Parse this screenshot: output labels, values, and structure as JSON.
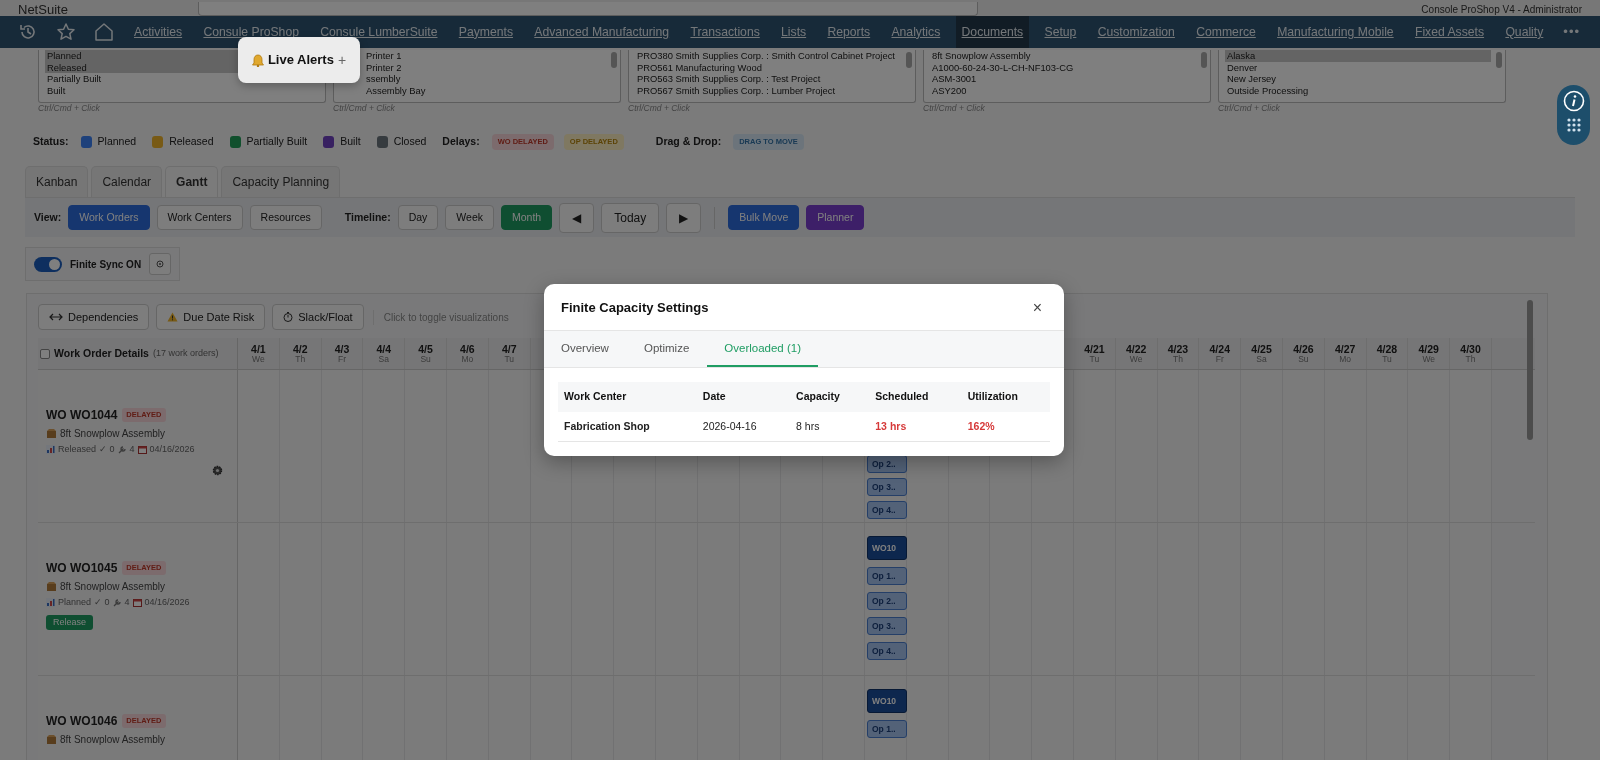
{
  "header": {
    "logo": "NetSuite",
    "user": "Console ProShop V4 - Administrator"
  },
  "nav": {
    "items": [
      {
        "label": "Activities",
        "selected": false
      },
      {
        "label": "Consule ProShop",
        "selected": false
      },
      {
        "label": "Consule LumberSuite",
        "selected": false
      },
      {
        "label": "Payments",
        "selected": false
      },
      {
        "label": "Advanced Manufacturing",
        "selected": false
      },
      {
        "label": "Transactions",
        "selected": false
      },
      {
        "label": "Lists",
        "selected": false
      },
      {
        "label": "Reports",
        "selected": false
      },
      {
        "label": "Analytics",
        "selected": false
      },
      {
        "label": "Documents",
        "selected": true
      },
      {
        "label": "Setup",
        "selected": false
      },
      {
        "label": "Customization",
        "selected": false
      },
      {
        "label": "Commerce",
        "selected": false
      },
      {
        "label": "Manufacturing Mobile",
        "selected": false
      },
      {
        "label": "Fixed Assets",
        "selected": false
      },
      {
        "label": "Quality",
        "selected": false
      }
    ],
    "more": "•••"
  },
  "live_alerts": {
    "label": "Live Alerts",
    "plus": "+"
  },
  "filters": [
    {
      "options": [
        {
          "label": "Planned",
          "selected": true
        },
        {
          "label": "Released",
          "selected": true
        },
        {
          "label": "Partially Built",
          "selected": false
        },
        {
          "label": "Built",
          "selected": false
        }
      ],
      "hint": "Ctrl/Cmd + Click"
    },
    {
      "options": [
        {
          "label": "Printer 1",
          "selected": false
        },
        {
          "label": "Printer 2",
          "selected": false
        },
        {
          "label": "ssembly",
          "selected": false
        },
        {
          "label": "Assembly Bay",
          "selected": false
        }
      ],
      "hint": "Ctrl/Cmd + Click"
    },
    {
      "options": [
        {
          "label": "PRO380 Smith Supplies Corp. : Smith Control Cabinet Project",
          "selected": false
        },
        {
          "label": "PRO561 Manufacturing Wood",
          "selected": false
        },
        {
          "label": "PRO563 Smith Supplies Corp. : Test Project",
          "selected": false
        },
        {
          "label": "PRO567 Smith Supplies Corp. : Lumber Project",
          "selected": false
        }
      ],
      "hint": "Ctrl/Cmd + Click"
    },
    {
      "options": [
        {
          "label": "8ft Snowplow Assembly",
          "selected": false
        },
        {
          "label": "A1000-60-24-30-L-CH-NF103-CG",
          "selected": false
        },
        {
          "label": "ASM-3001",
          "selected": false
        },
        {
          "label": "ASY200",
          "selected": false
        }
      ],
      "hint": "Ctrl/Cmd + Click"
    },
    {
      "options": [
        {
          "label": "Alaska",
          "selected": true
        },
        {
          "label": "Denver",
          "selected": false
        },
        {
          "label": "New Jersey",
          "selected": false
        },
        {
          "label": "Outside Processing",
          "selected": false
        }
      ],
      "hint": "Ctrl/Cmd + Click"
    }
  ],
  "legend": {
    "status_label": "Status:",
    "statuses": [
      {
        "label": "Planned",
        "color": "#1e417b"
      },
      {
        "label": "Released",
        "color": "#785a15"
      },
      {
        "label": "Partially Built",
        "color": "#11502d"
      },
      {
        "label": "Built",
        "color": "#382161"
      },
      {
        "label": "Closed",
        "color": "#363b3f"
      }
    ],
    "delays_label": "Delays:",
    "delays": [
      {
        "label": "WO DELAYED",
        "kind": "wo"
      },
      {
        "label": "OP DELAYED",
        "kind": "op"
      }
    ],
    "drag_label": "Drag & Drop:",
    "drag": "DRAG TO MOVE"
  },
  "view_tabs": [
    {
      "label": "Kanban",
      "selected": false
    },
    {
      "label": "Calendar",
      "selected": false
    },
    {
      "label": "Gantt",
      "selected": true
    },
    {
      "label": "Capacity Planning",
      "selected": false
    }
  ],
  "toolbar": {
    "view_label": "View:",
    "views": [
      {
        "label": "Work Orders",
        "selected": true
      },
      {
        "label": "Work Centers",
        "selected": false
      },
      {
        "label": "Resources",
        "selected": false
      }
    ],
    "timeline_label": "Timeline:",
    "timelines": [
      {
        "label": "Day",
        "selected": false
      },
      {
        "label": "Week",
        "selected": false
      },
      {
        "label": "Month",
        "selected": true
      }
    ],
    "prev": "◀",
    "today": "Today",
    "next": "▶",
    "actions": [
      {
        "label": "Bulk Move",
        "kind": "primary"
      },
      {
        "label": "Planner",
        "kind": "purple"
      }
    ]
  },
  "finite_sync": {
    "label": "Finite Sync ON",
    "on": true
  },
  "gantt": {
    "viz_buttons": [
      {
        "label": "Dependencies",
        "kind": "dependencies"
      },
      {
        "label": "Due Date Risk",
        "kind": "risk"
      },
      {
        "label": "Slack/Float",
        "kind": "slack"
      }
    ],
    "hint": "Click to toggle visualizations",
    "details_label": "Work Order Details",
    "details_checked": false,
    "count": "(17 work orders)",
    "days_left": [
      {
        "date": "4/1",
        "weekday": "We"
      },
      {
        "date": "4/2",
        "weekday": "Th"
      },
      {
        "date": "4/3",
        "weekday": "Fr"
      },
      {
        "date": "4/4",
        "weekday": "Sa"
      },
      {
        "date": "4/5",
        "weekday": "Su"
      },
      {
        "date": "4/6",
        "weekday": "Mo"
      },
      {
        "date": "4/7",
        "weekday": "Tu"
      }
    ],
    "days_right": [
      {
        "date": "4/21",
        "weekday": "Tu"
      },
      {
        "date": "4/22",
        "weekday": "We"
      },
      {
        "date": "4/23",
        "weekday": "Th"
      },
      {
        "date": "4/24",
        "weekday": "Fr"
      },
      {
        "date": "4/25",
        "weekday": "Sa"
      },
      {
        "date": "4/26",
        "weekday": "Su"
      },
      {
        "date": "4/27",
        "weekday": "Mo"
      },
      {
        "date": "4/28",
        "weekday": "Tu"
      },
      {
        "date": "4/29",
        "weekday": "We"
      },
      {
        "date": "4/30",
        "weekday": "Th"
      }
    ],
    "rows": [
      {
        "title": "WO WO1044",
        "badge": "DELAYED",
        "product": "8ft Snowplow Assembly",
        "meta": {
          "status": "Released",
          "done": "✓ 0",
          "ops": "4",
          "date": "04/16/2026"
        },
        "action": {
          "kind": "gear"
        },
        "bars": [
          {
            "label": "Op 2..",
            "kind": "op"
          },
          {
            "label": "Op 3..",
            "kind": "op"
          },
          {
            "label": "Op 4..",
            "kind": "op"
          }
        ]
      },
      {
        "title": "WO WO1045",
        "badge": "DELAYED",
        "product": "8ft Snowplow Assembly",
        "meta": {
          "status": "Planned",
          "done": "✓ 0",
          "ops": "4",
          "date": "04/16/2026"
        },
        "action": {
          "kind": "release",
          "label": "Release"
        },
        "bars": [
          {
            "label": "WO10",
            "kind": "wo"
          },
          {
            "label": "Op 1..",
            "kind": "op"
          },
          {
            "label": "Op 2..",
            "kind": "op"
          },
          {
            "label": "Op 3..",
            "kind": "op"
          },
          {
            "label": "Op 4..",
            "kind": "op"
          }
        ]
      },
      {
        "title": "WO WO1046",
        "badge": "DELAYED",
        "product": "8ft Snowplow Assembly",
        "bars": [
          {
            "label": "WO10",
            "kind": "wo"
          },
          {
            "label": "Op 1..",
            "kind": "op"
          }
        ]
      }
    ]
  },
  "modal": {
    "title": "Finite Capacity Settings",
    "close": "×",
    "tabs": [
      {
        "label": "Overview",
        "selected": false
      },
      {
        "label": "Optimize",
        "selected": false
      },
      {
        "label": "Overloaded (1)",
        "selected": true
      }
    ],
    "table": {
      "columns": [
        "Work Center",
        "Date",
        "Capacity",
        "Scheduled",
        "Utilization"
      ],
      "rows": [
        [
          {
            "text": "Fabrication Shop",
            "alert": false,
            "bold": true
          },
          {
            "text": "2026-04-16",
            "alert": false,
            "bold": false
          },
          {
            "text": "8 hrs",
            "alert": false,
            "bold": false
          },
          {
            "text": "13 hrs",
            "alert": true,
            "bold": true
          },
          {
            "text": "162%",
            "alert": true,
            "bold": true
          }
        ]
      ]
    }
  }
}
